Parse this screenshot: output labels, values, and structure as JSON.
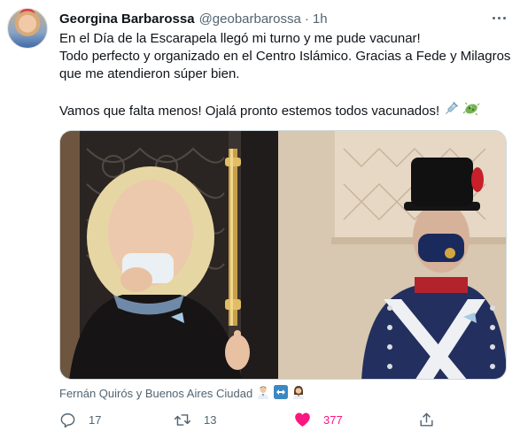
{
  "author": {
    "display_name": "Georgina Barbarossa",
    "handle": "@geobarbarossa",
    "separator": "·",
    "time": "1h"
  },
  "tweet": {
    "lines": [
      "En el Día de la Escarapela llegó mi turno y me pude vacunar!",
      "Todo perfecto y organizado en el Centro Islámico. Gracias a Fede y Milagros",
      "que me atendieron súper bien.",
      "Vamos que falta menos! Ojalá pronto estemos todos vacunados!"
    ],
    "trailing_emojis": [
      "syringe-icon",
      "microbe-icon"
    ]
  },
  "media": {
    "icons": [
      "photo-woman-scarf",
      "photo-grenadier-guard"
    ]
  },
  "tagged": {
    "text": "Fernán Quirós y Buenos Aires Ciudad",
    "emojis": [
      "man-doctor-emoji",
      "left-right-arrow-emoji",
      "woman-emoji"
    ]
  },
  "actions": {
    "reply_count": "17",
    "retweet_count": "13",
    "like_count": "377"
  },
  "colors": {
    "like": "#f91880",
    "muted": "#536471",
    "text": "#0f1419"
  }
}
